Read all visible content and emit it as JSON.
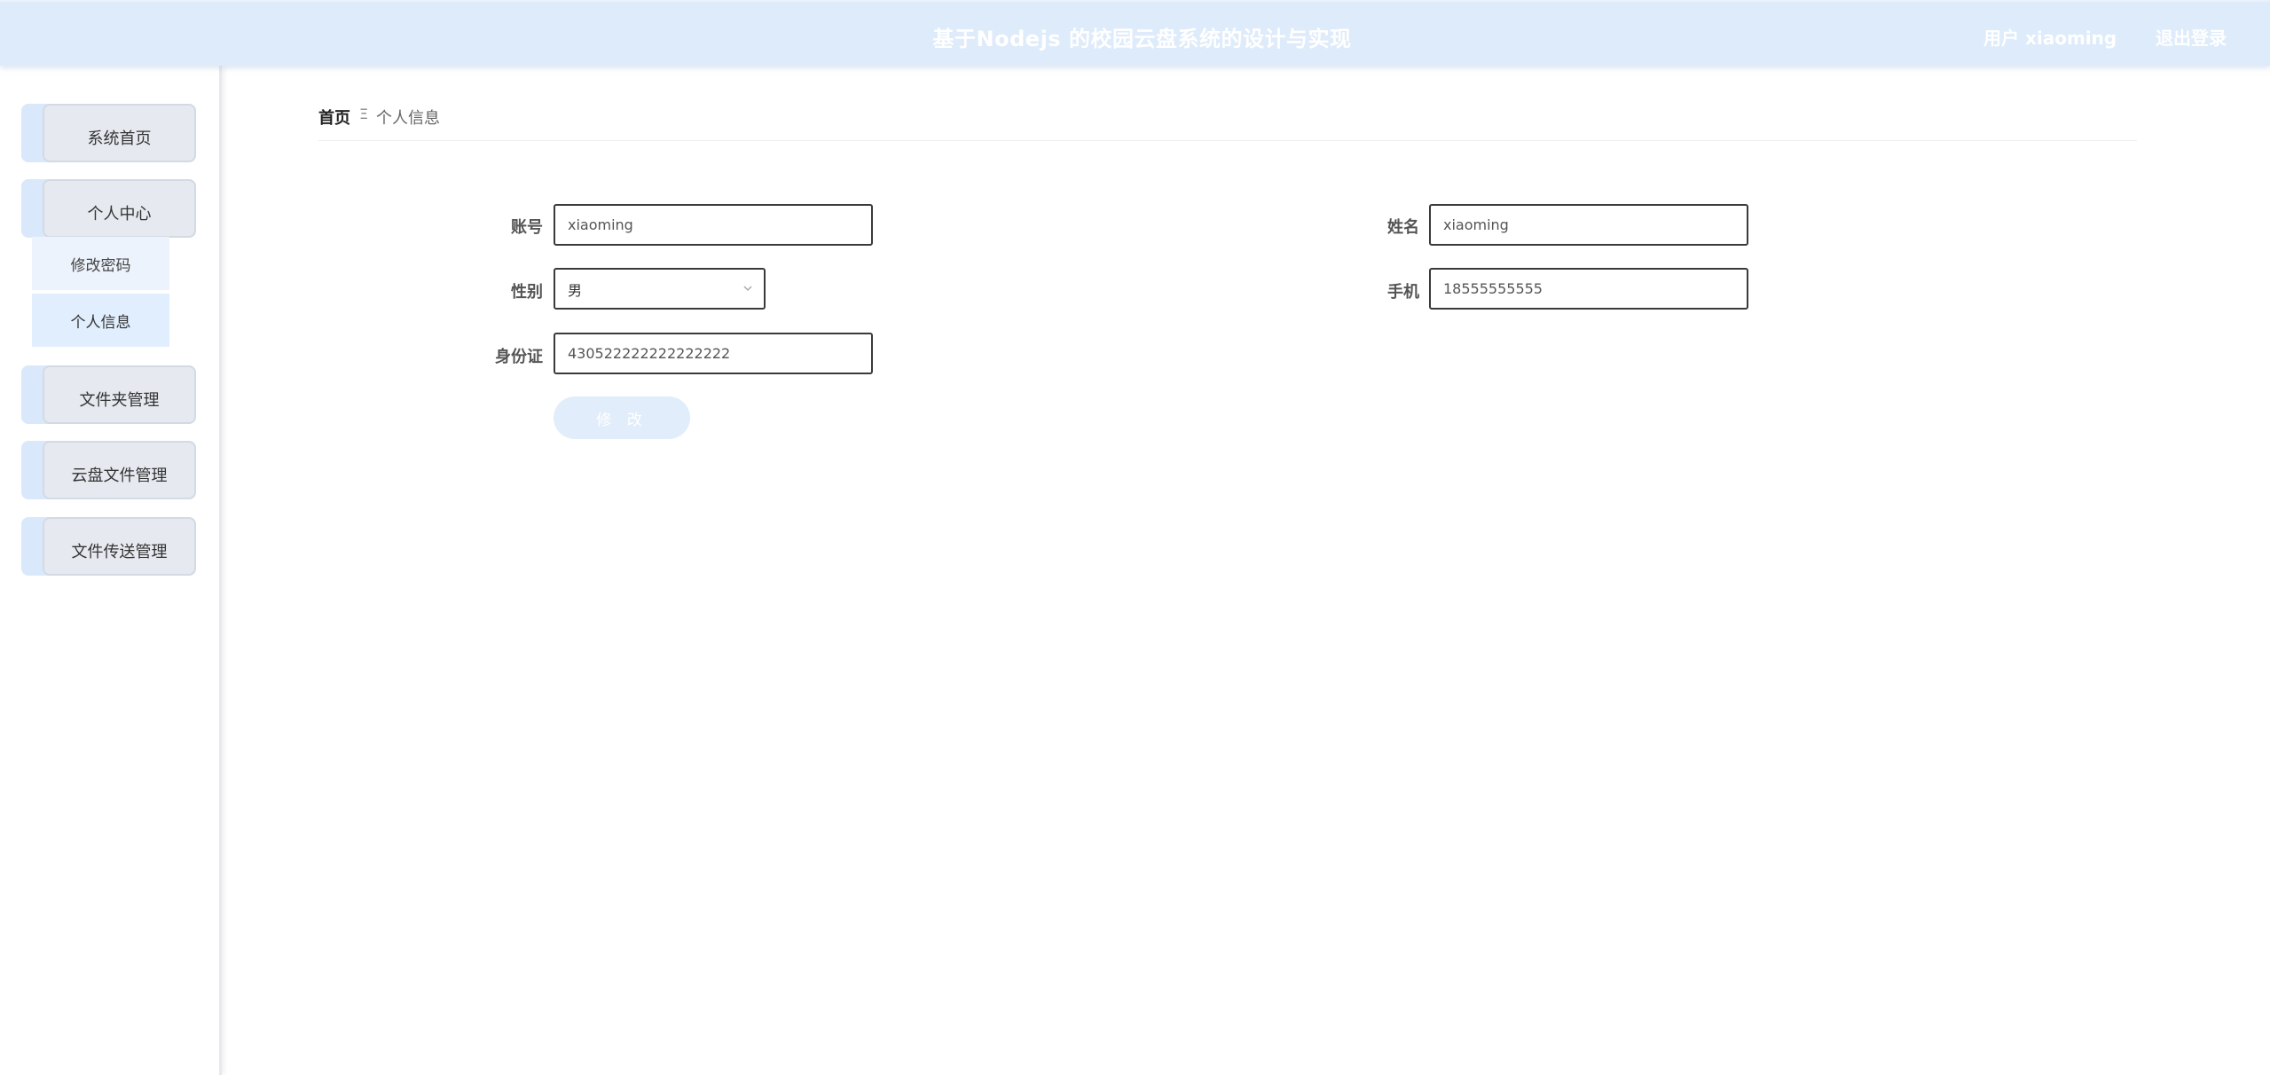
{
  "header": {
    "title": "基于Nodejs 的校园云盘系统的设计与实现",
    "user": "用户 xiaoming",
    "logout": "退出登录"
  },
  "sidebar": {
    "items": [
      {
        "label": "系统首页"
      },
      {
        "label": "个人中心",
        "children": [
          {
            "label": "修改密码"
          },
          {
            "label": "个人信息",
            "active": true
          }
        ]
      },
      {
        "label": "文件夹管理"
      },
      {
        "label": "云盘文件管理"
      },
      {
        "label": "文件传送管理"
      }
    ]
  },
  "breadcrumb": {
    "home": "首页",
    "separator": "Ξ",
    "current": "个人信息"
  },
  "form": {
    "account_label": "账号",
    "account_value": "xiaoming",
    "name_label": "姓名",
    "name_value": "xiaoming",
    "gender_label": "性别",
    "gender_value": "男",
    "phone_label": "手机",
    "phone_value": "18555555555",
    "id_label": "身份证",
    "id_value": "430522222222222222",
    "submit_label": "修 改"
  },
  "colors": {
    "header_bg": "#deebfa",
    "accent_light": "#e2edfb",
    "sidebar_active": "#e0eefd"
  }
}
